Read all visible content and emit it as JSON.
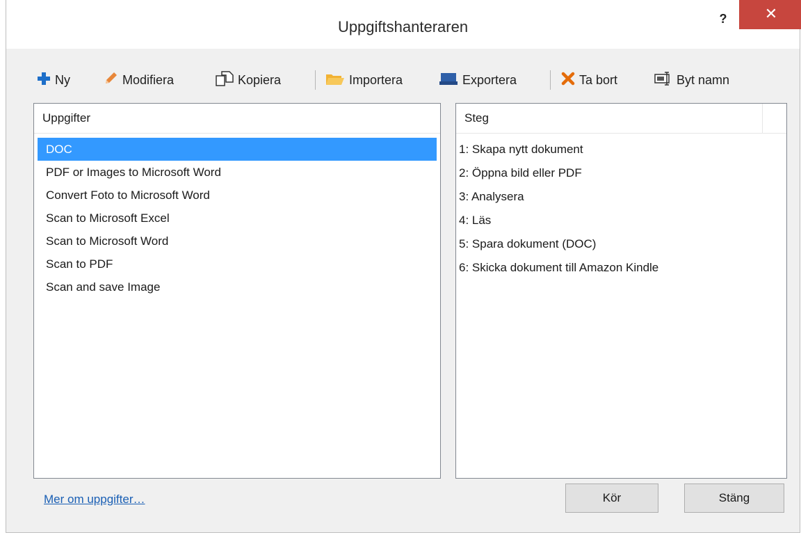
{
  "window": {
    "title": "Uppgiftshanteraren",
    "help_label": "?",
    "close_label": "✕"
  },
  "toolbar": {
    "new_label": "Ny",
    "modify_label": "Modifiera",
    "copy_label": "Kopiera",
    "import_label": "Importera",
    "export_label": "Exportera",
    "delete_label": "Ta bort",
    "rename_label": "Byt namn"
  },
  "tasks": {
    "header": "Uppgifter",
    "items": [
      "DOC",
      "PDF or Images to Microsoft Word",
      "Convert Foto to Microsoft Word",
      "Scan to Microsoft Excel",
      "Scan to Microsoft Word",
      "Scan to PDF",
      "Scan and save Image"
    ],
    "selected_index": 0
  },
  "steps": {
    "header": "Steg",
    "items": [
      "1: Skapa nytt dokument",
      "2: Öppna bild eller PDF",
      "3: Analysera",
      "4: Läs",
      "5: Spara dokument (DOC)",
      "6: Skicka dokument till Amazon Kindle"
    ]
  },
  "footer": {
    "more_link": "Mer om uppgifter…",
    "run_label": "Kör",
    "close_label": "Stäng"
  },
  "colors": {
    "selection": "#3399ff",
    "close_button": "#c7463e",
    "link": "#1a5fb4",
    "plus_icon": "#1e6fc9",
    "pencil_icon": "#e8873a",
    "folder_icon": "#f2b233",
    "export_icon": "#2e5fa8",
    "delete_icon": "#e46c0a"
  }
}
